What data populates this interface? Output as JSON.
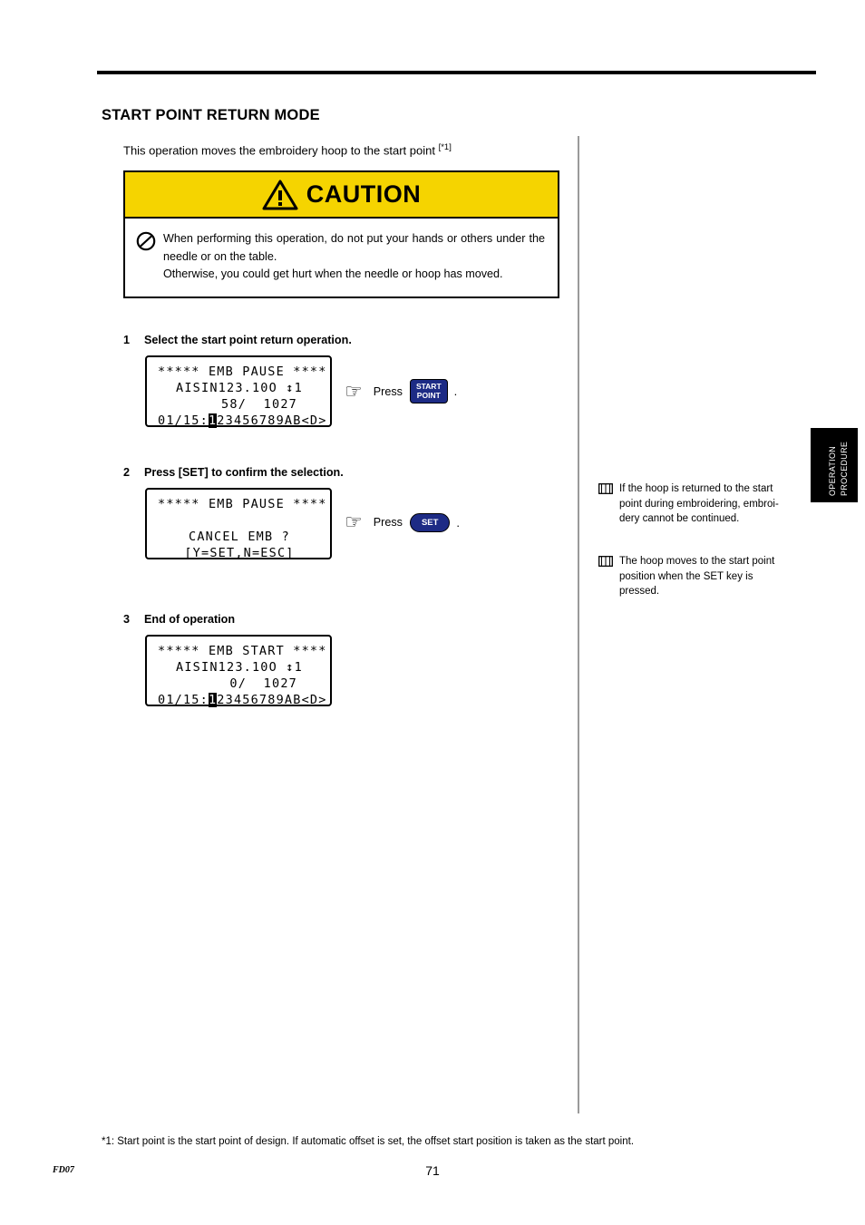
{
  "heading": "START POINT RETURN MODE",
  "intro": {
    "text": "This operation moves the embroidery hoop to the start point ",
    "footnote_ref": "[*1]"
  },
  "caution": {
    "title": "CAUTION",
    "line1": "When performing this operation, do not put your hands or others under the needle or on the table.",
    "line2": "Otherwise, you could get hurt when the needle or hoop has moved."
  },
  "steps": [
    {
      "number": "1",
      "label": "Select the start point return operation.",
      "display": {
        "line1": "***** EMB PAUSE ****",
        "line2_a": "AISIN123.10O",
        "line2_b": "1",
        "line3": "58/  1027",
        "line4_pre": "01/15:",
        "line4_hl": "1",
        "line4_post": "23456789AB<D>"
      },
      "press_word": "Press",
      "key_line1": "START",
      "key_line2": "POINT",
      "key_type": "start-point",
      "period": "."
    },
    {
      "number": "2",
      "label": "Press [SET] to confirm the selection.",
      "display": {
        "line1": "***** EMB PAUSE ****",
        "line2": "",
        "line3": "CANCEL EMB ?",
        "line4": "[Y=SET,N=ESC]"
      },
      "press_word": "Press",
      "key_label": "SET",
      "key_type": "set",
      "period": "."
    },
    {
      "number": "3",
      "label": "End of operation",
      "display": {
        "line1": "***** EMB START ****",
        "line2_a": "AISIN123.10O",
        "line2_b": "1",
        "line3": "0/  1027",
        "line4_pre": "01/15:",
        "line4_hl": "1",
        "line4_post": "23456789AB<D>"
      }
    }
  ],
  "side_tab": {
    "line1": "OPERATION",
    "line2": "PROCEDURE"
  },
  "notes": [
    "If the hoop is returned to the start point during embroidering, embroi-dery cannot be continued.",
    "The hoop moves to the start point position when the SET key is pressed."
  ],
  "footnote": "*1:  Start point is the start point of design. If automatic offset is set, the offset start position is taken as the start point.",
  "page_number": "71",
  "doc_code": "FD07",
  "colors": {
    "caution_bg": "#F5D400",
    "key_bg": "#1d2b85",
    "divider": "#9a9a9a"
  }
}
